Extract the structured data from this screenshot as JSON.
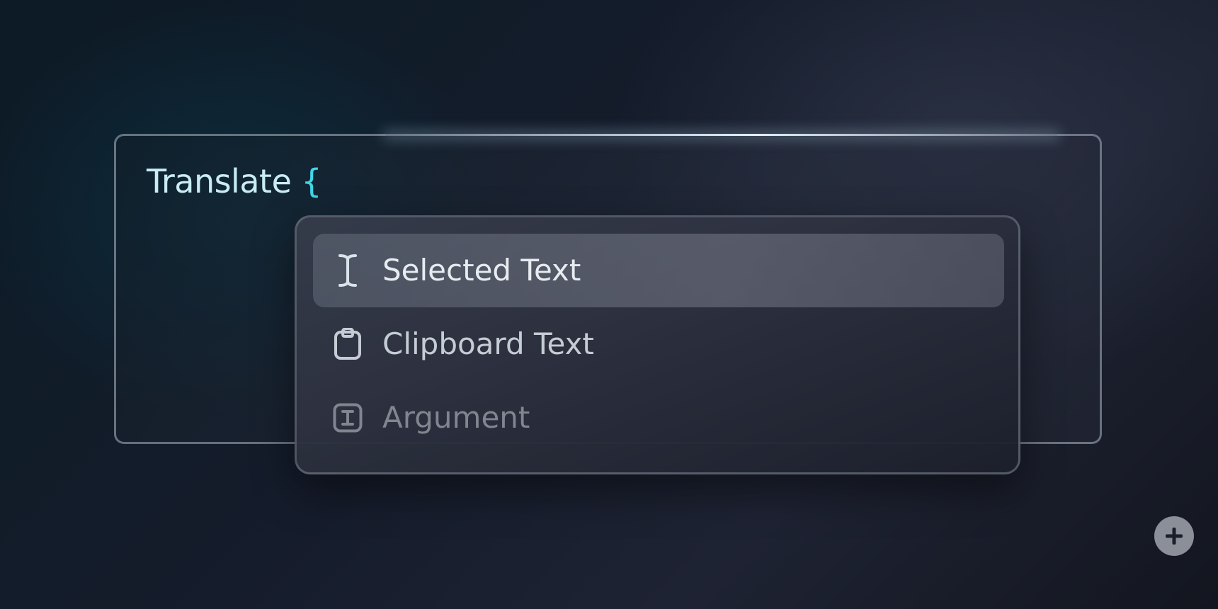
{
  "editor": {
    "prompt_word": "Translate",
    "prompt_brace": "{",
    "add_button_icon": "plus-icon"
  },
  "menu": {
    "items": [
      {
        "label": "Selected Text",
        "icon": "text-cursor-icon",
        "selected": true,
        "color": "#e6ecf0"
      },
      {
        "label": "Clipboard Text",
        "icon": "clipboard-icon",
        "selected": false,
        "color": "#c4ccd4"
      },
      {
        "label": "Argument",
        "icon": "argument-icon",
        "selected": false,
        "color": "#7f868f"
      }
    ]
  },
  "colors": {
    "accent": "#3fd6e8",
    "prompt_text": "#c9ecf4"
  }
}
